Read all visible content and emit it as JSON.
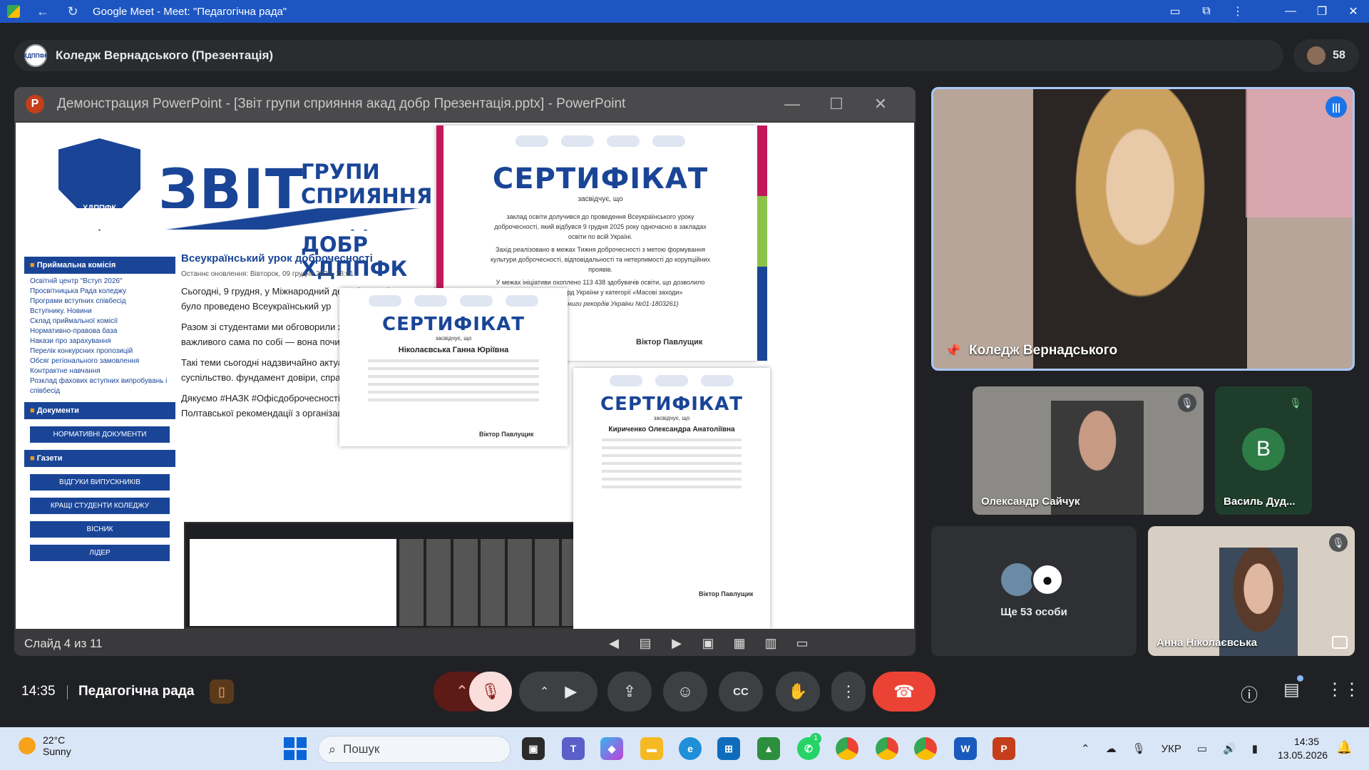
{
  "browser": {
    "window_title": "Google Meet - Meet: \"Педагогічна рада\"",
    "back_icon": "arrow-left-icon",
    "reload_icon": "reload-icon"
  },
  "header": {
    "presenter_name": "Коледж Вернадського (Презентація)",
    "logo_text": "ХДППФК",
    "participants_count": "58"
  },
  "powerpoint": {
    "window_title": "Демонстрация PowerPoint - [Звіт групи сприяння акад добр Презентація.pptx] - PowerPoint",
    "status": "Слайд 4 из 11",
    "slide": {
      "banner_title": "ЗВІТ",
      "banner_sub": "ГРУПИ СПРИЯННЯ\nАКАДЕМІЧНІЙ ДОБР\nХДППФК",
      "shield_text": "ХДППФК",
      "sidebar": {
        "heading1": "Приймальна комісія",
        "items": [
          "Освітній центр \"Вступ 2026\"",
          "Просвітницька Рада коледжу",
          "Програми вступних співбесід",
          "Вступнику. Новини",
          "Склад приймальної комісії",
          "Нормативно-правова база",
          "Накази про зарахування",
          "Перелік конкурсних пропозицій",
          "Обсяг регіонального замовлення",
          "Контрактне навчання",
          "Розклад фахових вступних випробувань і співбесід"
        ],
        "heading2": "Документи",
        "btn_docs": "НОРМАТИВНІ ДОКУМЕНТИ",
        "heading3": "Газети",
        "btns": [
          "ВІДГУКИ ВИПУСКНИКІВ",
          "КРАЩІ СТУДЕНТИ КОЛЕДЖУ",
          "ВІСНИК",
          "ЛІДЕР"
        ]
      },
      "article": {
        "title": "Всеукраїнський урок доброчесності",
        "date": "Останнє оновлення: Вівторок, 09 грудня 2025, 18:01",
        "p1": "Сьогодні, 9 грудня, у Міжнародний день боротьби з корупцією, разом з усіє нашому коледжі було проведено Всеукраїнський ур",
        "p2": "Разом зі студентами ми обговорили життєві к прийняття різних рішень. Прийшли до важливого сама по собі — вона починається з чесності, відп з нас.",
        "p3": "Такі теми сьогодні надзвичайно актуальні та ва виклики, які переживає українське суспільство. фундамент довіри, справедливості та спільної пер",
        "p4": "Дякуємо #НАЗК #Офісдоброчесності та Науковом гуманітарно-технологічна академія» Полтавської рекомендації з організації та проведення заходу"
      },
      "cert_main": {
        "title": "СЕРТИФІКАТ",
        "subtitle": "засвідчує, що",
        "text1": "заклад освіти долучився до проведення Всеукраїнського уроку доброчесності, який відбувся 9 грудня 2025 року одночасно в закладах освіти по всій Україні.",
        "text2": "Захід реалізовано в межах Тижня доброчесності з метою формування культури доброчесності, відповідальності та нетерпимості до корупційних проявів.",
        "text3": "У межах ініціативи охоплено 113 438 здобувачів освіти, що дозволило встановити рекорд України у категорії «Масові заходи»",
        "text4": "(сертифікат Книги рекордів України №01-1803261)",
        "signature": "Віктор Павлущик"
      },
      "cert_a": {
        "title": "СЕРТИФІКАТ",
        "subtitle": "засвідчує, що",
        "name": "Ніколаєвська Ганна Юріївна",
        "signature": "Віктор Павлущик"
      },
      "cert_b": {
        "title": "СЕРТИФІКАТ",
        "subtitle": "засвідчує, що",
        "name": "Кириченко Олександра Анатоліївна",
        "signature": "Віктор Павлущик"
      }
    }
  },
  "tiles": {
    "main": "Коледж Вернадського",
    "t1": "Олександр Сайчук",
    "t2": "Василь Дуд...",
    "t2_initial": "В",
    "t3": "Ще 53 особи",
    "t4": "Анна Ніколаєвська"
  },
  "controls": {
    "time": "14:35",
    "meeting_name": "Педагогічна рада"
  },
  "taskbar": {
    "temperature": "22°C",
    "weather": "Sunny",
    "search_placeholder": "Пошук",
    "lang": "УКР",
    "time": "14:35",
    "date": "13.05.2026",
    "whatsapp_badge": "1"
  },
  "colors": {
    "accent": "#1a4597",
    "meet_bg": "#202124",
    "hangup": "#ea4335",
    "taskbar": "#d9e6f7"
  }
}
